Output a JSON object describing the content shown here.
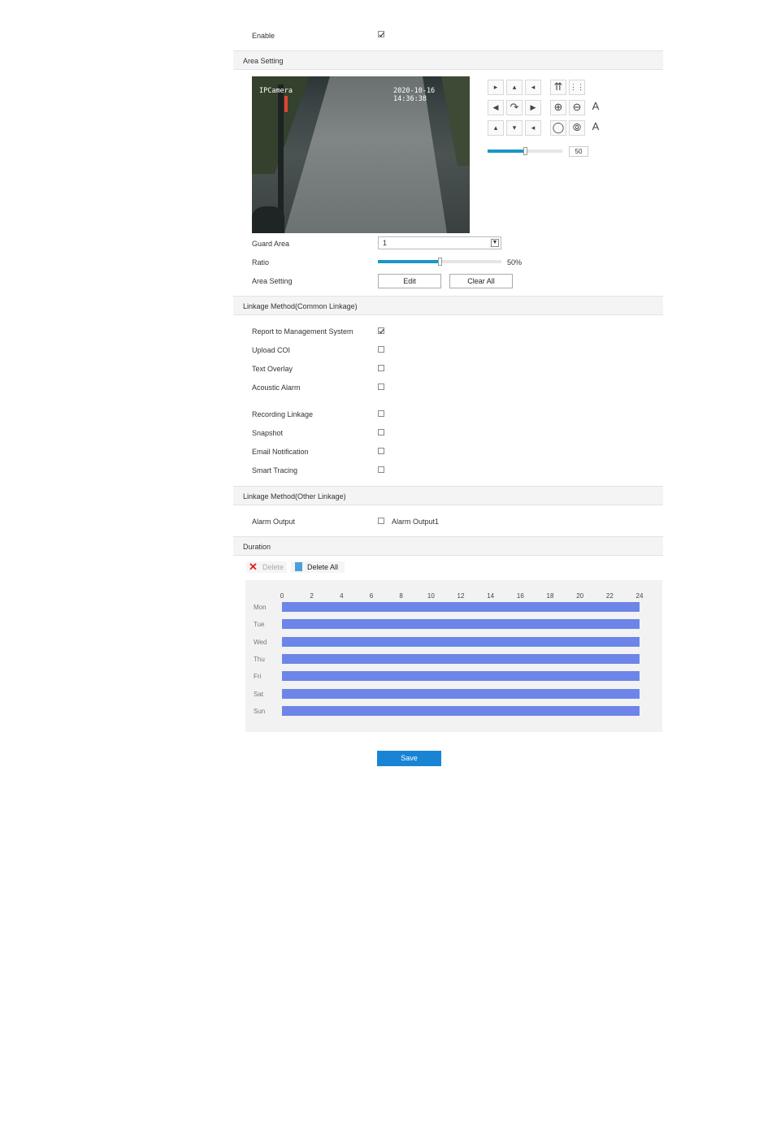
{
  "enable": {
    "label": "Enable",
    "checked": true
  },
  "area_section": {
    "title": "Area Setting"
  },
  "video": {
    "camera_name": "IPCamera",
    "timestamp": "2020-10-16 14:36:38"
  },
  "ptz": {
    "speed_value": "50",
    "speed_percent": 50
  },
  "guard_area": {
    "label": "Guard Area",
    "value": "1"
  },
  "ratio": {
    "label": "Ratio",
    "value": "50%",
    "percent": 50
  },
  "area_setting": {
    "label": "Area Setting",
    "edit_label": "Edit",
    "clear_label": "Clear All"
  },
  "common_linkage": {
    "title": "Linkage Method(Common Linkage)",
    "items": [
      {
        "label": "Report to Management System",
        "checked": true
      },
      {
        "label": "Upload COI",
        "checked": false
      },
      {
        "label": "Text Overlay",
        "checked": false
      },
      {
        "label": "Acoustic Alarm",
        "checked": false
      },
      {
        "label": "Recording Linkage",
        "checked": false
      },
      {
        "label": "Snapshot",
        "checked": false
      },
      {
        "label": "Email Notification",
        "checked": false
      },
      {
        "label": "Smart Tracing",
        "checked": false
      }
    ]
  },
  "other_linkage": {
    "title": "Linkage Method(Other Linkage)",
    "alarm_output_label": "Alarm Output",
    "alarm_output1_label": "Alarm Output1",
    "checked": false
  },
  "duration": {
    "title": "Duration",
    "delete_label": "Delete",
    "delete_all_label": "Delete All",
    "hours": [
      "0",
      "2",
      "4",
      "6",
      "8",
      "10",
      "12",
      "14",
      "16",
      "18",
      "20",
      "22",
      "24"
    ],
    "days": [
      "Mon",
      "Tue",
      "Wed",
      "Thu",
      "Fri",
      "Sat",
      "Sun"
    ],
    "bar_color": "#6d84e8"
  },
  "save_label": "Save"
}
